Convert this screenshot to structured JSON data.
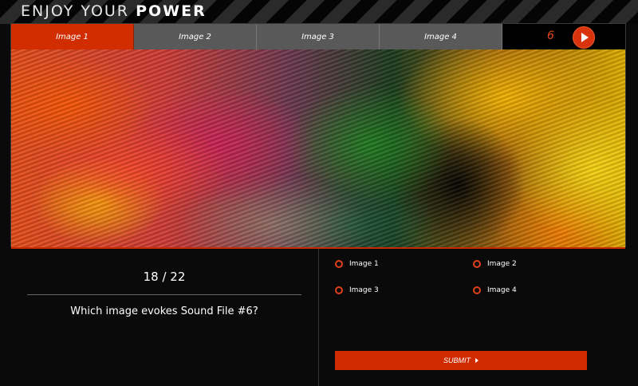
{
  "brand": {
    "prefix": "ENJOY YOUR",
    "emphasis": "POWER"
  },
  "tabs": [
    {
      "label": "Image 1",
      "active": true
    },
    {
      "label": "Image 2",
      "active": false
    },
    {
      "label": "Image 3",
      "active": false
    },
    {
      "label": "Image 4",
      "active": false
    }
  ],
  "timer": {
    "value": "6"
  },
  "quiz": {
    "progress": "18 / 22",
    "question": "Which image evokes Sound File #6?"
  },
  "options": [
    {
      "label": "Image 1"
    },
    {
      "label": "Image 2"
    },
    {
      "label": "Image 3"
    },
    {
      "label": "Image 4"
    }
  ],
  "submit": {
    "label": "SUBMIT"
  },
  "colors": {
    "accent": "#d22d00",
    "tab_inactive": "#595959",
    "background": "#0a0a0a"
  }
}
